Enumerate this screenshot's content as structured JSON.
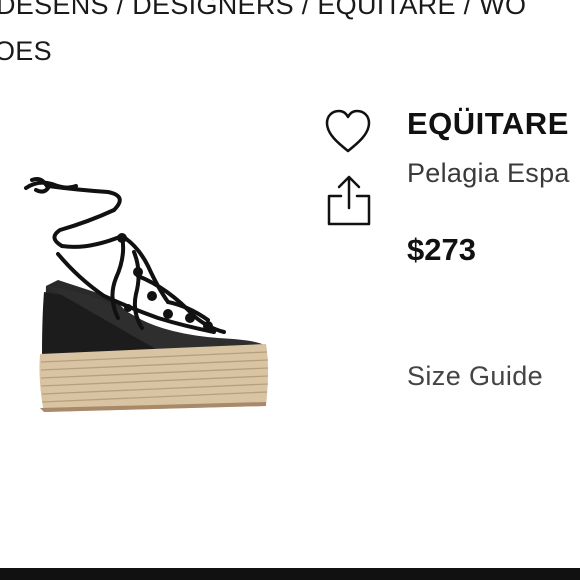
{
  "breadcrumb": {
    "line1": "DESENS / DESIGNERS / EQÜITARE / WO",
    "line2": "OES"
  },
  "product": {
    "brand": "EQÜITARE",
    "name": "Pelagia Espa",
    "price": "$273"
  },
  "links": {
    "size_guide": "Size Guide"
  },
  "icons": {
    "wishlist": "heart-icon",
    "share": "share-icon"
  },
  "colors": {
    "text": "#111111",
    "muted": "#444444",
    "bottom_bar": "#111111"
  }
}
